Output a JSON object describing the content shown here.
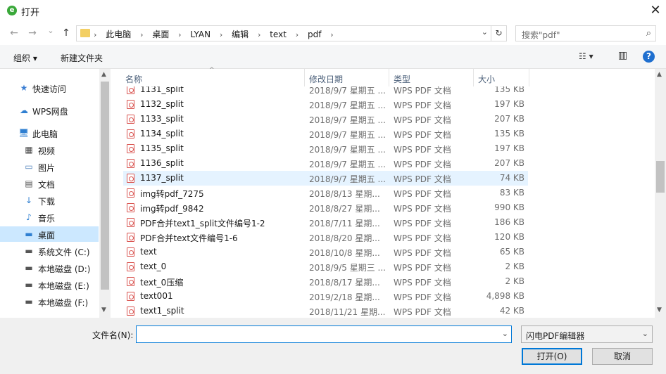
{
  "window": {
    "title": "打开",
    "close_glyph": "✕"
  },
  "nav": {
    "back_glyph": "←",
    "forward_glyph": "→",
    "recent_glyph": "⌄",
    "up_glyph": "↑",
    "sep_glyph": "›",
    "breadcrumbs": [
      "此电脑",
      "桌面",
      "LYAN",
      "编辑",
      "text",
      "pdf"
    ],
    "dropdown_glyph": "⌄",
    "refresh_glyph": "↻",
    "search_placeholder": "搜索\"pdf\"",
    "search_glyph": "⌕"
  },
  "toolbar": {
    "organize_label": "组织 ▾",
    "new_folder_label": "新建文件夹",
    "view_glyph": "☷ ▾",
    "pane_glyph": "▥",
    "help_glyph": "?"
  },
  "sidebar": {
    "items": [
      {
        "label": "快速访问",
        "icon": "★",
        "icon_color": "#3c7fd3"
      },
      {
        "label": "WPS网盘",
        "icon": "☁",
        "icon_color": "#2f7fd1"
      },
      {
        "label": "此电脑",
        "icon": "🖥",
        "icon_color": "#2f7fd1"
      },
      {
        "label": "视频",
        "icon": "▦",
        "icon_color": "#444444"
      },
      {
        "label": "图片",
        "icon": "▭",
        "icon_color": "#4a7eb8"
      },
      {
        "label": "文档",
        "icon": "▤",
        "icon_color": "#555555"
      },
      {
        "label": "下载",
        "icon": "↓",
        "icon_color": "#2f7fd1"
      },
      {
        "label": "音乐",
        "icon": "♪",
        "icon_color": "#2f7fd1"
      },
      {
        "label": "桌面",
        "icon": "▬",
        "icon_color": "#2f7fd1"
      },
      {
        "label": "系统文件 (C:)",
        "icon": "▬",
        "icon_color": "#555555"
      },
      {
        "label": "本地磁盘 (D:)",
        "icon": "▬",
        "icon_color": "#555555"
      },
      {
        "label": "本地磁盘 (E:)",
        "icon": "▬",
        "icon_color": "#555555"
      },
      {
        "label": "本地磁盘 (F:)",
        "icon": "▬",
        "icon_color": "#555555"
      }
    ],
    "selected_index": 8,
    "scroll_up": "▲",
    "scroll_down": "▼"
  },
  "columns": {
    "name": "名称",
    "date": "修改日期",
    "type": "类型",
    "size": "大小",
    "sort_glyph": "^"
  },
  "files": [
    {
      "name": "1131_split",
      "date": "2018/9/7 星期五 ...",
      "type": "WPS PDF 文档",
      "size": "135 KB"
    },
    {
      "name": "1132_split",
      "date": "2018/9/7 星期五 ...",
      "type": "WPS PDF 文档",
      "size": "197 KB"
    },
    {
      "name": "1133_split",
      "date": "2018/9/7 星期五 ...",
      "type": "WPS PDF 文档",
      "size": "207 KB"
    },
    {
      "name": "1134_split",
      "date": "2018/9/7 星期五 ...",
      "type": "WPS PDF 文档",
      "size": "135 KB"
    },
    {
      "name": "1135_split",
      "date": "2018/9/7 星期五 ...",
      "type": "WPS PDF 文档",
      "size": "197 KB"
    },
    {
      "name": "1136_split",
      "date": "2018/9/7 星期五 ...",
      "type": "WPS PDF 文档",
      "size": "207 KB"
    },
    {
      "name": "1137_split",
      "date": "2018/9/7 星期五 ...",
      "type": "WPS PDF 文档",
      "size": "74 KB"
    },
    {
      "name": "img转pdf_7275",
      "date": "2018/8/13 星期...",
      "type": "WPS PDF 文档",
      "size": "83 KB"
    },
    {
      "name": "img转pdf_9842",
      "date": "2018/8/27 星期...",
      "type": "WPS PDF 文档",
      "size": "990 KB"
    },
    {
      "name": "PDF合并text1_split文件编号1-2",
      "date": "2018/7/11 星期...",
      "type": "WPS PDF 文档",
      "size": "186 KB"
    },
    {
      "name": "PDF合并text文件编号1-6",
      "date": "2018/8/20 星期...",
      "type": "WPS PDF 文档",
      "size": "120 KB"
    },
    {
      "name": "text",
      "date": "2018/10/8 星期...",
      "type": "WPS PDF 文档",
      "size": "65 KB"
    },
    {
      "name": "text_0",
      "date": "2018/9/5 星期三 ...",
      "type": "WPS PDF 文档",
      "size": "2 KB"
    },
    {
      "name": "text_0压缩",
      "date": "2018/8/17 星期...",
      "type": "WPS PDF 文档",
      "size": "2 KB"
    },
    {
      "name": "text001",
      "date": "2019/2/18 星期...",
      "type": "WPS PDF 文档",
      "size": "4,898 KB"
    },
    {
      "name": "text1_split",
      "date": "2018/11/21 星期...",
      "type": "WPS PDF 文档",
      "size": "42 KB"
    }
  ],
  "selected_file_index": 6,
  "bottom": {
    "filename_label": "文件名(N):",
    "filename_value": "",
    "dropdown_glyph": "⌄",
    "filter_value": "闪电PDF编辑器",
    "open_label": "打开(O)",
    "cancel_label": "取消"
  }
}
